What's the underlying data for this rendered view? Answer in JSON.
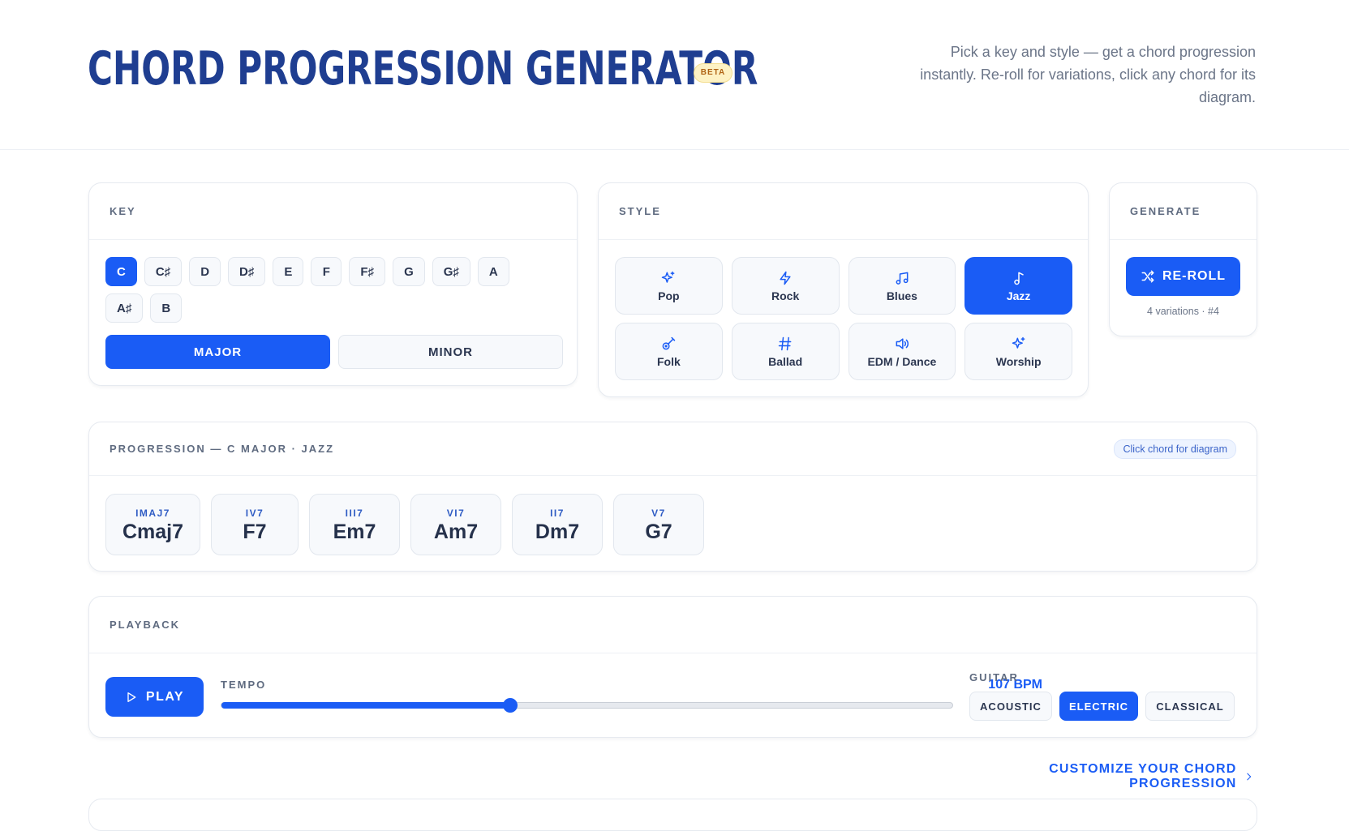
{
  "header": {
    "title": "CHORD PROGRESSION GENERATOR",
    "badge": "BETA",
    "tagline": "Pick a key and style — get a chord progression instantly. Re-roll for variations, click any chord for its diagram."
  },
  "key": {
    "label": "KEY",
    "keys": [
      "C",
      "C♯",
      "D",
      "D♯",
      "E",
      "F",
      "F♯",
      "G",
      "G♯",
      "A",
      "A♯",
      "B"
    ],
    "selected": "C",
    "modes": [
      "MAJOR",
      "MINOR"
    ],
    "selected_mode": "MAJOR"
  },
  "style": {
    "label": "STYLE",
    "items": [
      {
        "label": "Pop",
        "icon": "sparkles-icon"
      },
      {
        "label": "Rock",
        "icon": "lightning-icon"
      },
      {
        "label": "Blues",
        "icon": "music-notes-icon"
      },
      {
        "label": "Jazz",
        "icon": "music-note-icon"
      },
      {
        "label": "Folk",
        "icon": "guitar-icon"
      },
      {
        "label": "Ballad",
        "icon": "hash-icon"
      },
      {
        "label": "EDM / Dance",
        "icon": "speaker-icon"
      },
      {
        "label": "Worship",
        "icon": "sparkles-icon"
      }
    ],
    "selected": "Jazz"
  },
  "generate": {
    "label": "GENERATE",
    "button": "RE-ROLL",
    "variations": "4 variations · #4"
  },
  "progression": {
    "label": "PROGRESSION — C MAJOR · JAZZ",
    "hint": "Click chord for diagram",
    "chords": [
      {
        "numeral": "IMAJ7",
        "name": "Cmaj7"
      },
      {
        "numeral": "IV7",
        "name": "F7"
      },
      {
        "numeral": "III7",
        "name": "Em7"
      },
      {
        "numeral": "VI7",
        "name": "Am7"
      },
      {
        "numeral": "II7",
        "name": "Dm7"
      },
      {
        "numeral": "V7",
        "name": "G7"
      }
    ]
  },
  "playback": {
    "label": "PLAYBACK",
    "play_button": "PLAY",
    "tempo_label": "TEMPO",
    "bpm_text": "107 BPM",
    "tempo_fraction": 0.395,
    "guitar_label": "GUITAR",
    "guitars": [
      "ACOUSTIC",
      "ELECTRIC",
      "CLASSICAL"
    ],
    "selected_guitar": "ELECTRIC"
  },
  "customize_link": "CUSTOMIZE YOUR CHORD PROGRESSION",
  "colors": {
    "accent": "#1a5cf5",
    "title": "#1f3e91"
  }
}
